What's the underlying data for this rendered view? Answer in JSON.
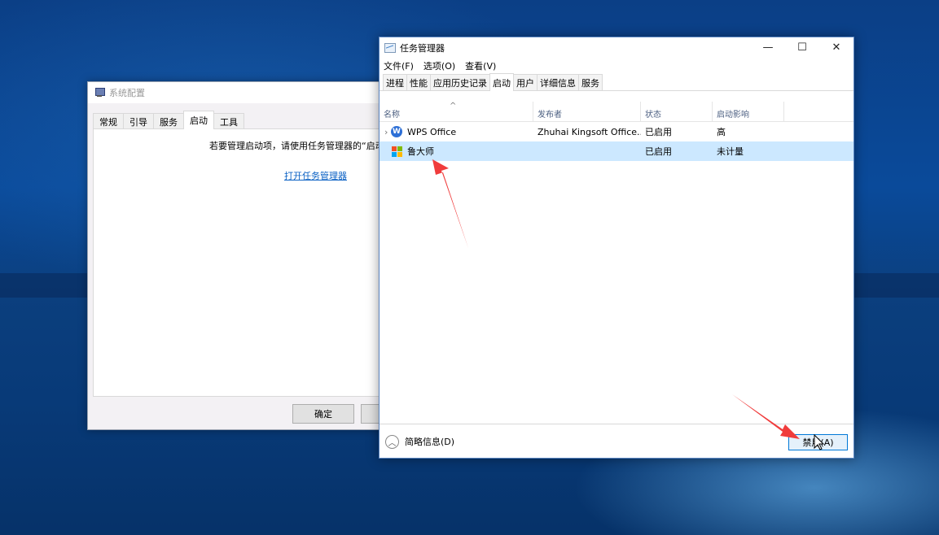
{
  "msconfig": {
    "title": "系统配置",
    "tabs": [
      {
        "label": "常规",
        "active": false
      },
      {
        "label": "引导",
        "active": false
      },
      {
        "label": "服务",
        "active": false
      },
      {
        "label": "启动",
        "active": true
      },
      {
        "label": "工具",
        "active": false
      }
    ],
    "notice": "若要管理启动项，请使用任务管理器的“启动”",
    "link": "打开任务管理器",
    "buttons": {
      "ok": "确定",
      "cancel": ""
    }
  },
  "taskmgr": {
    "title": "任务管理器",
    "window_controls": {
      "minimize": "—",
      "maximize": "☐",
      "close": "✕"
    },
    "menu": [
      "文件(F)",
      "选项(O)",
      "查看(V)"
    ],
    "tabs": [
      {
        "label": "进程",
        "active": false
      },
      {
        "label": "性能",
        "active": false
      },
      {
        "label": "应用历史记录",
        "active": false
      },
      {
        "label": "启动",
        "active": true
      },
      {
        "label": "用户",
        "active": false
      },
      {
        "label": "详细信息",
        "active": false
      },
      {
        "label": "服务",
        "active": false
      }
    ],
    "columns": [
      "名称",
      "发布者",
      "状态",
      "启动影响"
    ],
    "sort_indicator": "^",
    "rows": [
      {
        "name": "WPS Office",
        "publisher": "Zhuhai Kingsoft Office...",
        "status": "已启用",
        "impact": "高",
        "icon": "wps-icon",
        "expandable": true,
        "selected": false
      },
      {
        "name": "鲁大师",
        "publisher": "",
        "status": "已启用",
        "impact": "未计量",
        "icon": "ludashi-icon",
        "expandable": false,
        "selected": true
      }
    ],
    "footer": {
      "fewer_details": "简略信息(D)",
      "disable_button": "禁用(A)"
    }
  },
  "colors": {
    "selection": "#cce8ff",
    "accent": "#0078d7",
    "link": "#0b61c4",
    "annotation_arrow": "#f03c3c"
  }
}
